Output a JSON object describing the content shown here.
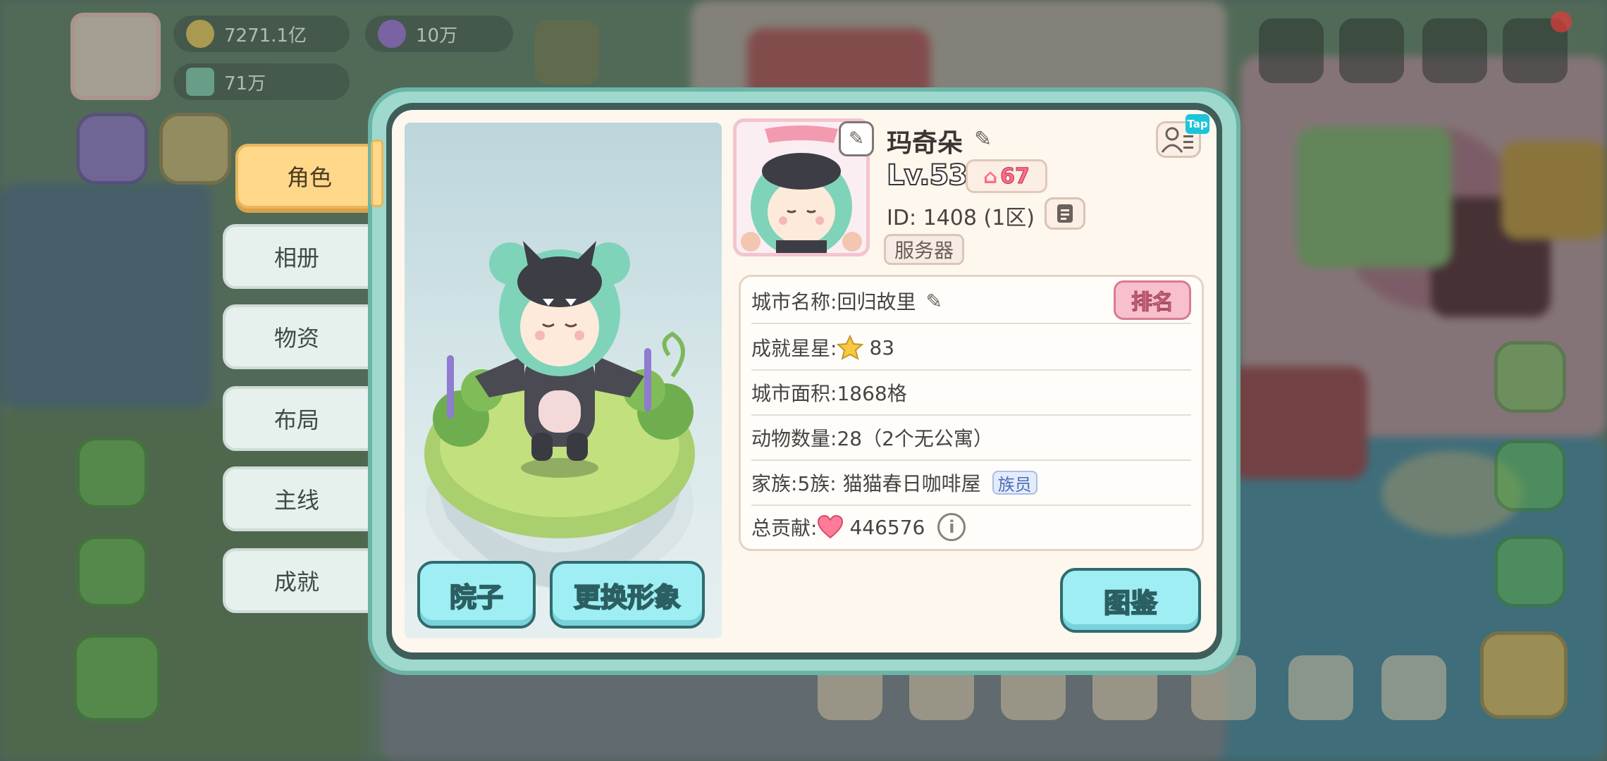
{
  "hud": {
    "coins": "7271.1亿",
    "gems": "10万",
    "tickets": "71万"
  },
  "tabs": [
    {
      "label": "角色",
      "active": true
    },
    {
      "label": "相册",
      "active": false
    },
    {
      "label": "物资",
      "active": false
    },
    {
      "label": "布局",
      "active": false
    },
    {
      "label": "主线",
      "active": false
    },
    {
      "label": "成就",
      "active": false
    }
  ],
  "profile": {
    "name": "玛奇朵",
    "level": "Lv.53",
    "home_level": "67",
    "id_label": "ID:",
    "id_value": "1408 (1区)",
    "server_label": "服务器",
    "tap_badge": "Tap"
  },
  "info": {
    "city_name_label": "城市名称:",
    "city_name": "回归故里",
    "rank_button": "排名",
    "stars_label": "成就星星:",
    "stars": "83",
    "area_label": "城市面积:",
    "area": "1868格",
    "animals_label": "动物数量:",
    "animals": "28（2个无公寓）",
    "family_label": "家族:",
    "family": "5族: 猫猫春日咖啡屋",
    "family_role": "族员",
    "contribution_label": "总贡献:",
    "contribution": "446576",
    "info_icon_text": "i"
  },
  "buttons": {
    "yard": "院子",
    "change_look": "更换形象",
    "encyclopedia": "图鉴"
  },
  "colors": {
    "dialog_frame": "#9fd8cd",
    "active_tab": "#ffd889",
    "action_button": "#9eeef3",
    "rank_button": "#f8bfcc"
  }
}
